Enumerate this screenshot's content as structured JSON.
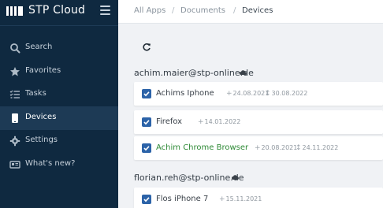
{
  "app": {
    "title": "STP Cloud"
  },
  "sidebar": {
    "items": [
      {
        "label": "Search",
        "icon": "search-icon"
      },
      {
        "label": "Favorites",
        "icon": "star-icon"
      },
      {
        "label": "Tasks",
        "icon": "tasks-icon"
      },
      {
        "label": "Devices",
        "icon": "device-icon",
        "active": true
      },
      {
        "label": "Settings",
        "icon": "gear-icon"
      },
      {
        "label": "What's new?",
        "icon": "newspaper-icon"
      }
    ]
  },
  "breadcrumb": [
    {
      "label": "All Apps"
    },
    {
      "label": "Documents"
    },
    {
      "label": "Devices"
    }
  ],
  "breadcrumb_sep": "/",
  "groups": [
    {
      "email": "achim.maier@stp-online.de",
      "devices": [
        {
          "name": "Achims Iphone",
          "added": "24.08.2021",
          "synced": "30.08.2022",
          "checked": true,
          "highlight": false
        },
        {
          "name": "Firefox",
          "added": "14.01.2022",
          "synced": null,
          "checked": true,
          "highlight": false
        },
        {
          "name": "Achim Chrome Browser",
          "added": "20.08.2021",
          "synced": "24.11.2022",
          "checked": true,
          "highlight": true
        }
      ]
    },
    {
      "email": "florian.reh@stp-online.de",
      "devices": [
        {
          "name": "Flos iPhone 7",
          "added": "15.11.2021",
          "synced": null,
          "checked": true,
          "highlight": false
        }
      ]
    }
  ],
  "colors": {
    "sidebar_bg": "#0f2940",
    "sidebar_active": "#1d3a55",
    "checkbox": "#2c63a8",
    "highlight_text": "#2e8a36"
  }
}
